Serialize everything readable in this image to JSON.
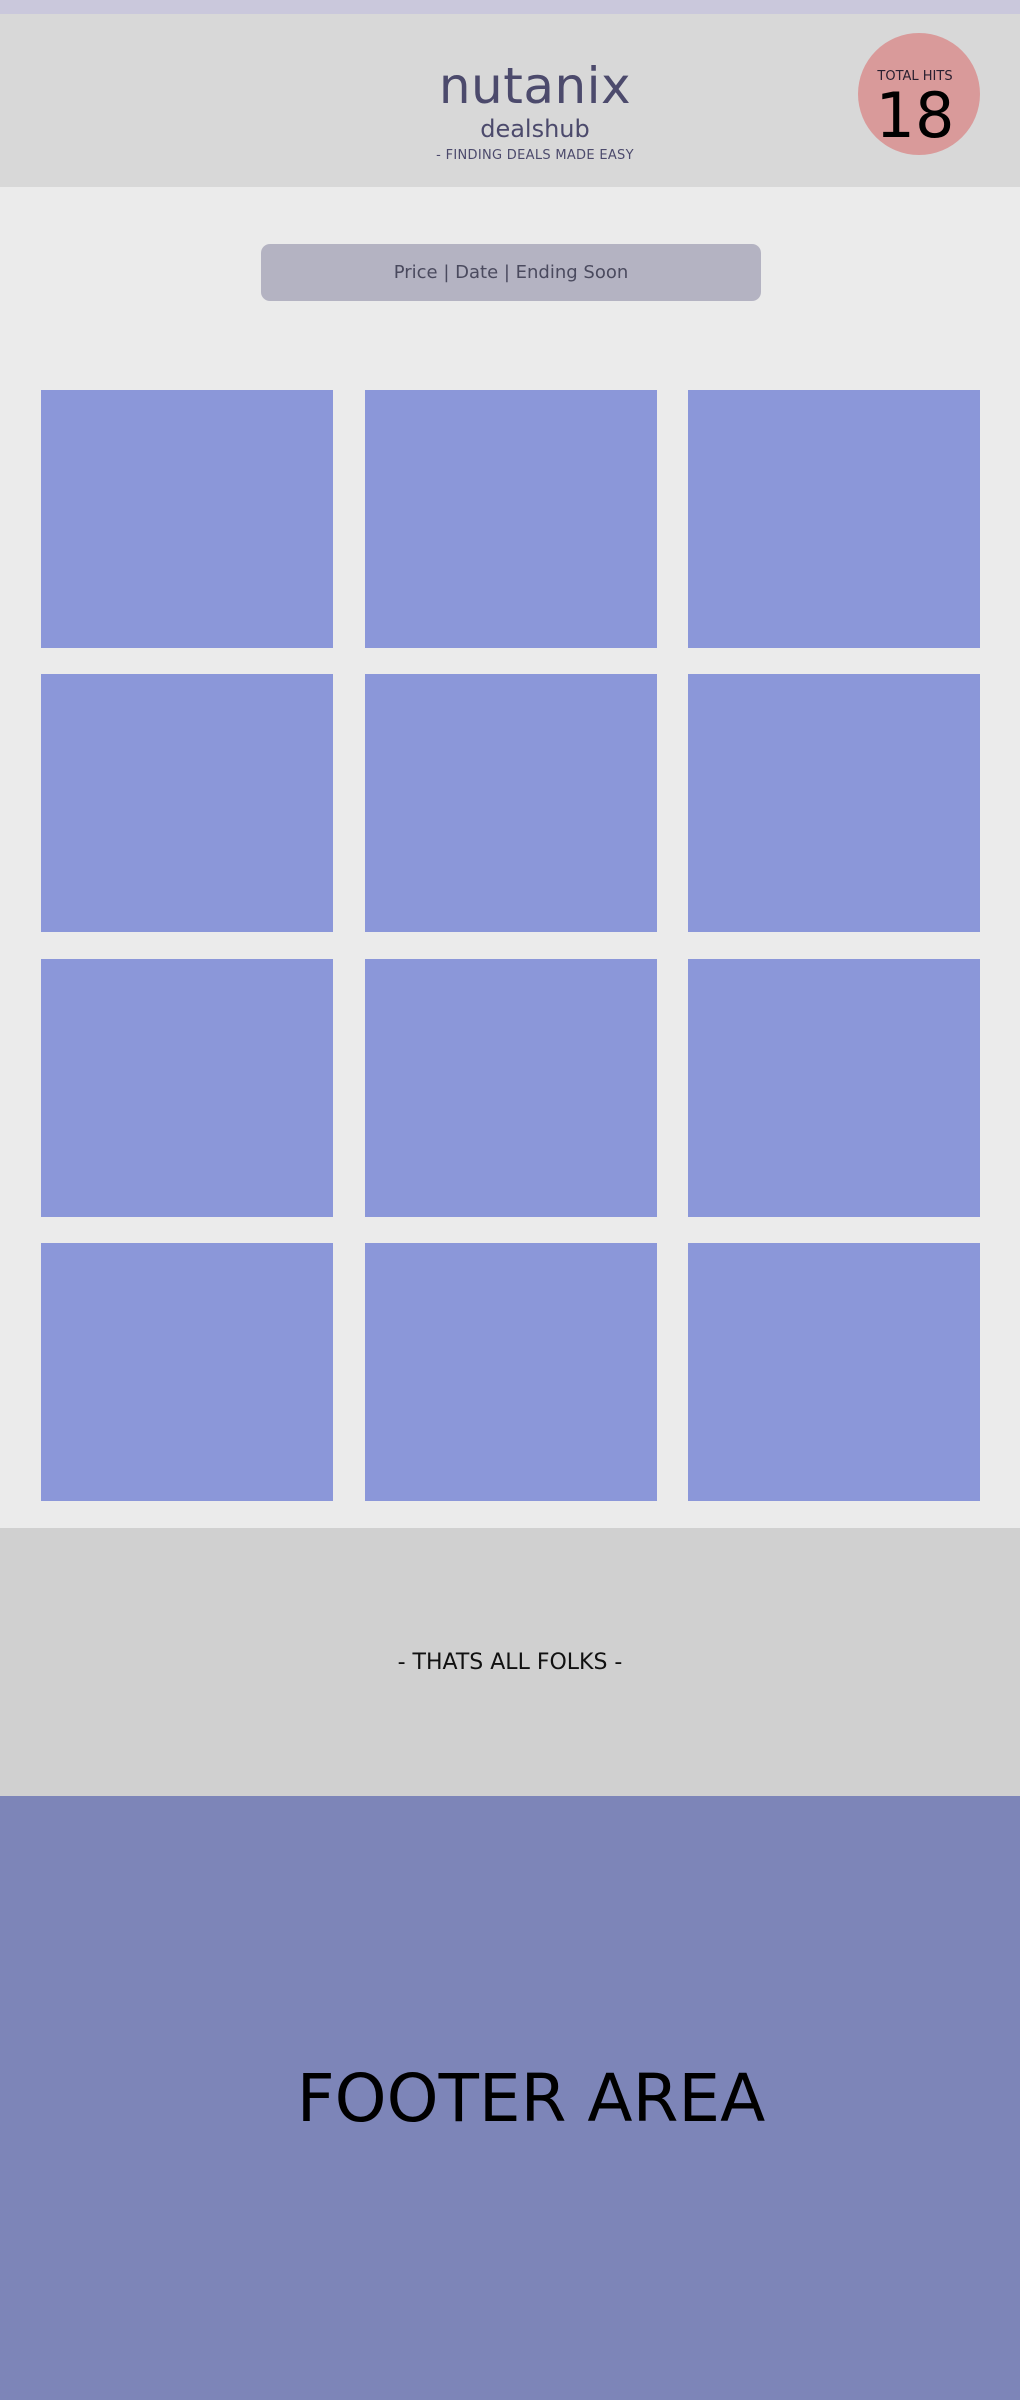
{
  "header": {
    "title": "nutanix",
    "subtitle": "dealshub",
    "tagline": "- FINDING DEALS MADE EASY"
  },
  "hits": {
    "label": "TOTAL HITS",
    "count": "18"
  },
  "sort": {
    "label": "Price | Date | Ending Soon"
  },
  "content": {
    "end_message": "- THATS ALL FOLKS -"
  },
  "footer": {
    "label": "FOOTER AREA"
  },
  "colors": {
    "header_bg": "#d8d8d8",
    "badge": "#d99a9a",
    "card": "#8b97d9",
    "footer": "#7d85b8"
  }
}
